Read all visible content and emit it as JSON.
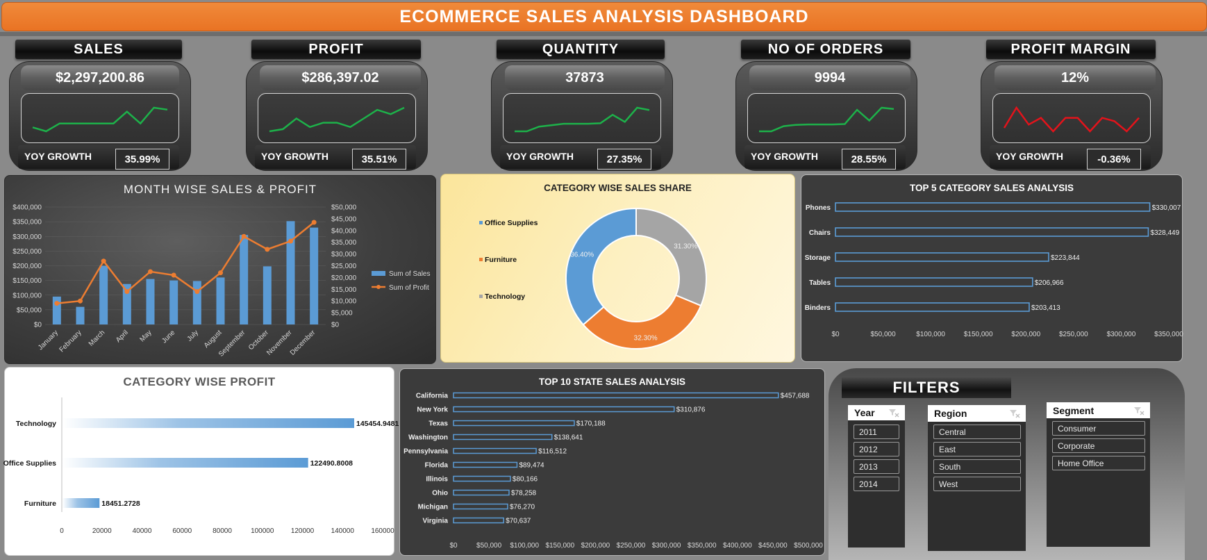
{
  "title": "ECOMMERCE SALES ANALYSIS DASHBOARD",
  "kpis": [
    {
      "label": "SALES",
      "value": "$2,297,200.86",
      "yoy_label": "YOY GROWTH",
      "yoy": "35.99%",
      "spark": [
        3,
        2,
        4,
        4,
        4,
        4,
        4,
        7,
        4,
        8,
        7.5
      ],
      "color": "#1db24a"
    },
    {
      "label": "PROFIT",
      "value": "$286,397.02",
      "yoy_label": "YOY GROWTH",
      "yoy": "35.51%",
      "spark": [
        2,
        2.5,
        5,
        3,
        4,
        4,
        3,
        5,
        7,
        6,
        7.5
      ],
      "color": "#1db24a"
    },
    {
      "label": "QUANTITY",
      "value": "37873",
      "yoy_label": "YOY GROWTH",
      "yoy": "27.35%",
      "spark": [
        2,
        2,
        3,
        3.3,
        3.6,
        3.6,
        3.6,
        3.7,
        5.5,
        4,
        7,
        6.5
      ],
      "color": "#1db24a"
    },
    {
      "label": "NO OF ORDERS",
      "value": "9994",
      "yoy_label": "YOY GROWTH",
      "yoy": "28.55%",
      "spark": [
        2,
        2,
        3.2,
        3.5,
        3.6,
        3.6,
        3.6,
        3.7,
        7,
        4.5,
        7.5,
        7.2
      ],
      "color": "#1db24a"
    },
    {
      "label": "PROFIT MARGIN",
      "value": "12%",
      "yoy_label": "YOY GROWTH",
      "yoy": "-0.36%",
      "spark": [
        3,
        6,
        3.5,
        4.5,
        2.5,
        4.5,
        4.5,
        2.5,
        4.5,
        4,
        2.5,
        4.5
      ],
      "color": "#e3131b"
    }
  ],
  "month_chart": {
    "title": "MONTH WISE SALES & PROFIT",
    "legend": [
      "Sum of Sales",
      "Sum of Profit"
    ],
    "left_ticks": [
      "$400,000",
      "$350,000",
      "$300,000",
      "$250,000",
      "$200,000",
      "$150,000",
      "$100,000",
      "$50,000",
      "$0"
    ],
    "right_ticks": [
      "$50,000",
      "$45,000",
      "$40,000",
      "$35,000",
      "$30,000",
      "$25,000",
      "$20,000",
      "$15,000",
      "$10,000",
      "$5,000",
      "$0"
    ]
  },
  "category_share": {
    "title": "CATEGORY WISE SALES SHARE",
    "legend": [
      "Office Supplies",
      "Furniture",
      "Technology"
    ]
  },
  "top5": {
    "title": "TOP 5 CATEGORY SALES ANALYSIS",
    "x_ticks": [
      "$0",
      "$50,000",
      "$100,000",
      "$150,000",
      "$200,000",
      "$250,000",
      "$300,000",
      "$350,000"
    ]
  },
  "cat_profit": {
    "title": "CATEGORY WISE PROFIT",
    "x_ticks": [
      "0",
      "20000",
      "40000",
      "60000",
      "80000",
      "100000",
      "120000",
      "140000",
      "160000"
    ]
  },
  "top10": {
    "title": "TOP 10 STATE SALES ANALYSIS",
    "x_ticks": [
      "$0",
      "$50,000",
      "$100,000",
      "$150,000",
      "$200,000",
      "$250,000",
      "$300,000",
      "$350,000",
      "$400,000",
      "$450,000",
      "$500,000"
    ]
  },
  "filters": {
    "title": "FILTERS",
    "year": {
      "label": "Year",
      "items": [
        "2011",
        "2012",
        "2013",
        "2014"
      ]
    },
    "region": {
      "label": "Region",
      "items": [
        "Central",
        "East",
        "South",
        "West"
      ]
    },
    "segment": {
      "label": "Segment",
      "items": [
        "Consumer",
        "Corporate",
        "Home Office"
      ]
    }
  },
  "chart_data": [
    {
      "type": "bar",
      "title": "MONTH WISE SALES & PROFIT",
      "categories": [
        "January",
        "February",
        "March",
        "April",
        "May",
        "June",
        "July",
        "August",
        "September",
        "October",
        "November",
        "December"
      ],
      "series": [
        {
          "name": "Sum of Sales",
          "values": [
            95000,
            60000,
            200000,
            138000,
            155000,
            150000,
            148000,
            160000,
            305000,
            198000,
            352000,
            330000
          ]
        },
        {
          "name": "Sum of Profit",
          "values": [
            9000,
            10000,
            27000,
            14000,
            22500,
            21000,
            14000,
            22000,
            37500,
            32000,
            35500,
            43500
          ]
        }
      ],
      "ylim": [
        0,
        400000
      ],
      "y2lim": [
        0,
        50000
      ],
      "legend_position": "right"
    },
    {
      "type": "pie",
      "title": "CATEGORY WISE SALES SHARE",
      "labels": [
        "Technology",
        "Furniture",
        "Office Supplies"
      ],
      "values": [
        36.4,
        32.3,
        31.3
      ],
      "value_labels": [
        "36.40%",
        "32.30%",
        "31.30%"
      ],
      "colors": [
        "#5b9bd5",
        "#ed7d31",
        "#a5a5a5"
      ],
      "legend_position": "left"
    },
    {
      "type": "bar",
      "title": "TOP 5 CATEGORY SALES ANALYSIS",
      "categories": [
        "Phones",
        "Chairs",
        "Storage",
        "Tables",
        "Binders"
      ],
      "values": [
        330007,
        328449,
        223844,
        206966,
        203413
      ],
      "value_labels": [
        "$330,007",
        "$328,449",
        "$223,844",
        "$206,966",
        "$203,413"
      ],
      "xlim": [
        0,
        350000
      ]
    },
    {
      "type": "bar",
      "title": "CATEGORY WISE PROFIT",
      "categories": [
        "Technology",
        "Office Supplies",
        "Furniture"
      ],
      "values": [
        145454.9481,
        122490.8008,
        18451.2728
      ],
      "value_labels": [
        "145454.9481",
        "122490.8008",
        "18451.2728"
      ],
      "xlim": [
        0,
        160000
      ]
    },
    {
      "type": "bar",
      "title": "TOP 10 STATE SALES ANALYSIS",
      "categories": [
        "California",
        "New York",
        "Texas",
        "Washington",
        "Pennsylvania",
        "Florida",
        "Illinois",
        "Ohio",
        "Michigan",
        "Virginia"
      ],
      "values": [
        457688,
        310876,
        170188,
        138641,
        116512,
        89474,
        80166,
        78258,
        76270,
        70637
      ],
      "value_labels": [
        "$457,688",
        "$310,876",
        "$170,188",
        "$138,641",
        "$116,512",
        "$89,474",
        "$80,166",
        "$78,258",
        "$76,270",
        "$70,637"
      ],
      "xlim": [
        0,
        500000
      ]
    }
  ]
}
